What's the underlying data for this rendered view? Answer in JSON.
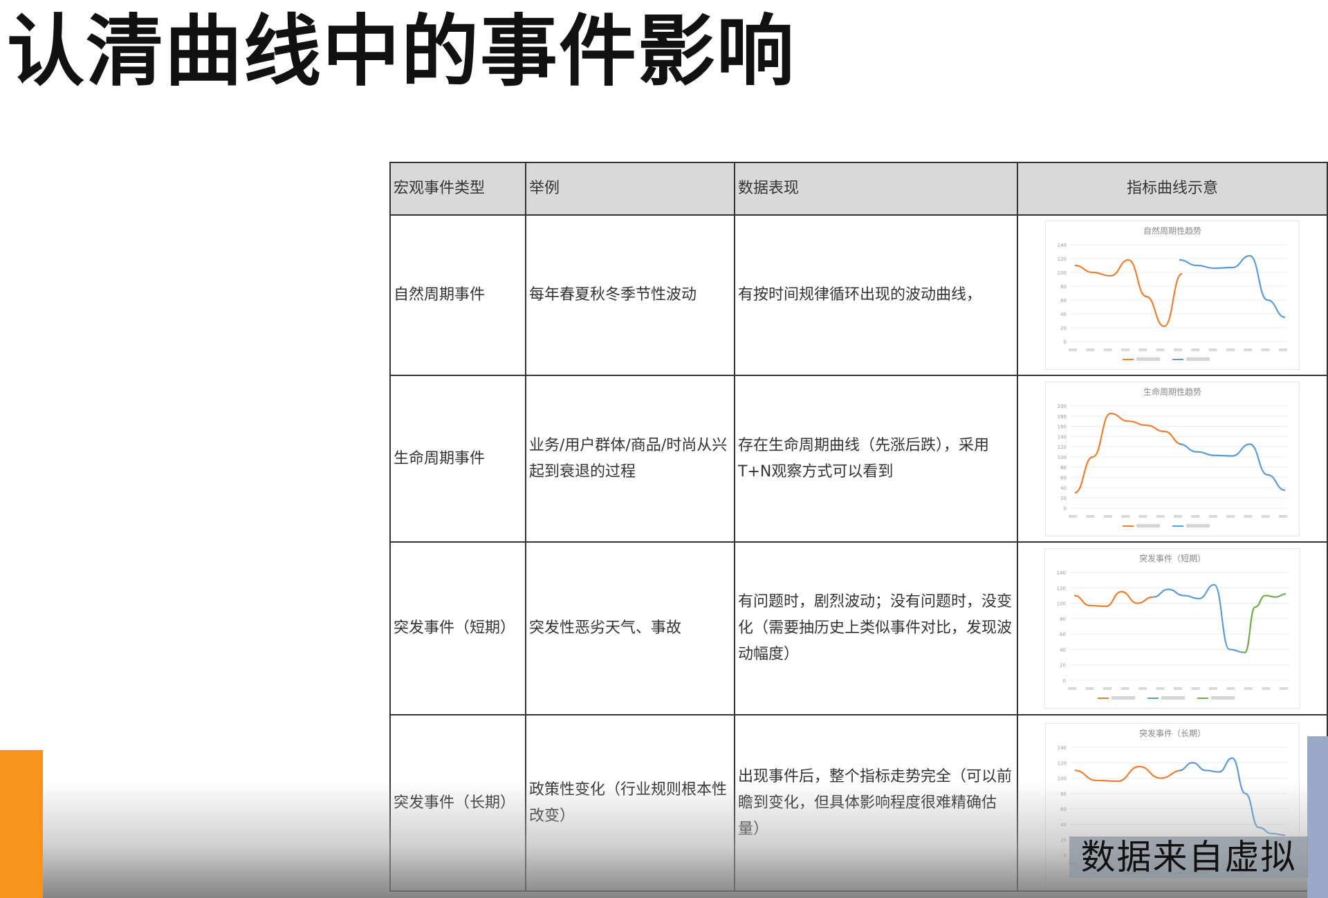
{
  "slide": {
    "title": "认清曲线中的事件影响"
  },
  "table": {
    "headers": [
      "宏观事件类型",
      "举例",
      "数据表现",
      "指标曲线示意"
    ],
    "rows": [
      {
        "type": "自然周期事件",
        "example": "每年春夏秋冬季节性波动",
        "data_pattern": "有按时间规律循环出现的波动曲线，",
        "chart_title": "自然周期性趋势",
        "chart": {
          "type": "line",
          "ylim": [
            0,
            140
          ],
          "yticks": [
            "0",
            "20",
            "40",
            "60",
            "80",
            "100",
            "120",
            "140"
          ],
          "series": [
            {
              "color": "#ed7d31",
              "values": [
                110,
                100,
                95,
                118,
                65,
                22,
                98
              ]
            },
            {
              "color": "#5b9bd5",
              "values": [
                118,
                110,
                106,
                107,
                124,
                60,
                35
              ]
            }
          ]
        }
      },
      {
        "type": "生命周期事件",
        "example": "业务/用户群体/商品/时尚从兴起到衰退的过程",
        "data_pattern": "存在生命周期曲线（先涨后跌），采用T+N观察方式可以看到",
        "chart_title": "生命周期性趋势",
        "chart": {
          "type": "line",
          "ylim": [
            0,
            200
          ],
          "yticks": [
            "0",
            "20",
            "40",
            "60",
            "80",
            "100",
            "120",
            "140",
            "160",
            "180",
            "200"
          ],
          "series": [
            {
              "color": "#ed7d31",
              "values": [
                30,
                100,
                185,
                170,
                162,
                150,
                125
              ]
            },
            {
              "color": "#5b9bd5",
              "values": [
                125,
                110,
                103,
                102,
                125,
                65,
                35
              ]
            }
          ]
        }
      },
      {
        "type": "突发事件（短期）",
        "example": "突发性恶劣天气、事故",
        "data_pattern": "有问题时，剧烈波动；没有问题时，没变化（需要抽历史上类似事件对比，发现波动幅度）",
        "chart_title": "突发事件（短期）",
        "chart": {
          "type": "line",
          "ylim": [
            0,
            140
          ],
          "yticks": [
            "0",
            "20",
            "40",
            "60",
            "80",
            "100",
            "120",
            "140"
          ],
          "series": [
            {
              "color": "#ed7d31",
              "values": [
                110,
                97,
                96,
                115,
                100,
                108
              ]
            },
            {
              "color": "#5b9bd5",
              "values": [
                108,
                118,
                110,
                106,
                124,
                40,
                36
              ]
            },
            {
              "color": "#70ad47",
              "values": [
                36,
                95,
                110,
                108,
                112
              ]
            }
          ]
        }
      },
      {
        "type": "突发事件（长期）",
        "example": "政策性变化（行业规则根本性改变）",
        "data_pattern": "出现事件后，整个指标走势完全（可以前瞻到变化，但具体影响程度很难精确估量）",
        "chart_title": "突发事件（长期）",
        "chart": {
          "type": "line",
          "ylim": [
            0,
            140
          ],
          "yticks": [
            "0",
            "20",
            "40",
            "60",
            "80",
            "100",
            "120",
            "140"
          ],
          "series": [
            {
              "color": "#ed7d31",
              "values": [
                110,
                97,
                96,
                115,
                100,
                110
              ]
            },
            {
              "color": "#5b9bd5",
              "values": [
                110,
                120,
                110,
                108,
                126,
                80,
                36,
                28,
                26
              ]
            }
          ]
        }
      }
    ]
  },
  "watermark": "数据来自虚拟"
}
